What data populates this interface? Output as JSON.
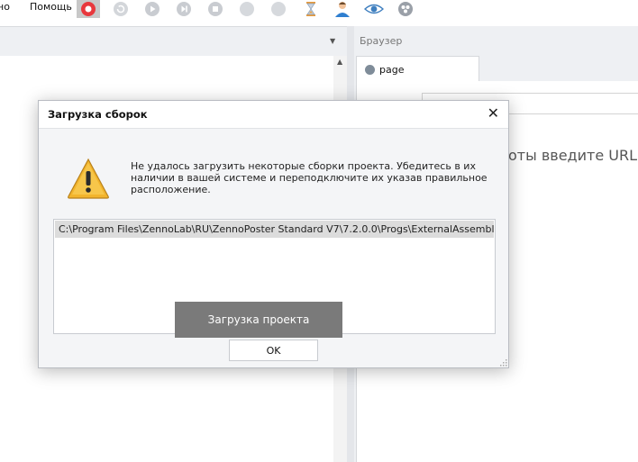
{
  "menu": {
    "items": [
      {
        "label": "но"
      },
      {
        "label": "Помощь"
      }
    ]
  },
  "toolbar": {
    "buttons": [
      {
        "icon": "record-icon",
        "active": true
      },
      {
        "icon": "refresh-icon"
      },
      {
        "icon": "play-icon"
      },
      {
        "icon": "step-icon"
      },
      {
        "icon": "stop-icon"
      },
      {
        "icon": "disabled-icon"
      },
      {
        "icon": "disabled-icon"
      },
      {
        "icon": "hourglass-icon"
      },
      {
        "icon": "user-icon"
      },
      {
        "icon": "eye-icon"
      },
      {
        "icon": "network-icon"
      }
    ]
  },
  "browser": {
    "title": "Браузер",
    "tab_label": "page",
    "url_value": "",
    "content_hint": "оты введите URL"
  },
  "dialog": {
    "title": "Загрузка сборок",
    "message": "Не удалось загрузить некоторые сборки проекта. Убедитесь в их наличии в вашей системе и переподключите их указав правильное расположение.",
    "paths": [
      "C:\\Program Files\\ZennoLab\\RU\\ZennoPoster Standard V7\\7.2.0.0\\Progs\\ExternalAssemblies\\ImageF"
    ],
    "ok_label": "OK",
    "loading_text": "Загрузка проекта"
  },
  "colors": {
    "record": "#e8383d",
    "toolbar_disabled": "#c9ccd1",
    "warning_fill": "#f2b42c",
    "overlay": "#7a7a7a"
  }
}
